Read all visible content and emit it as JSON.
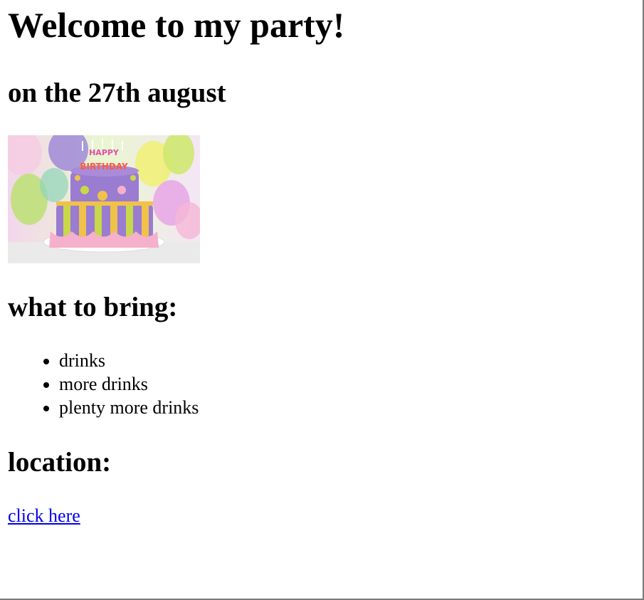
{
  "heading": "Welcome to my party!",
  "date": "on the 27th august",
  "image": {
    "candle_text": "HAPPY BIRTHDAY"
  },
  "bring": {
    "heading": "what to bring:",
    "items": [
      "drinks",
      "more drinks",
      "plenty more drinks"
    ]
  },
  "location": {
    "heading": "location:",
    "link_text": "click here",
    "link_color": "#0000ee"
  }
}
